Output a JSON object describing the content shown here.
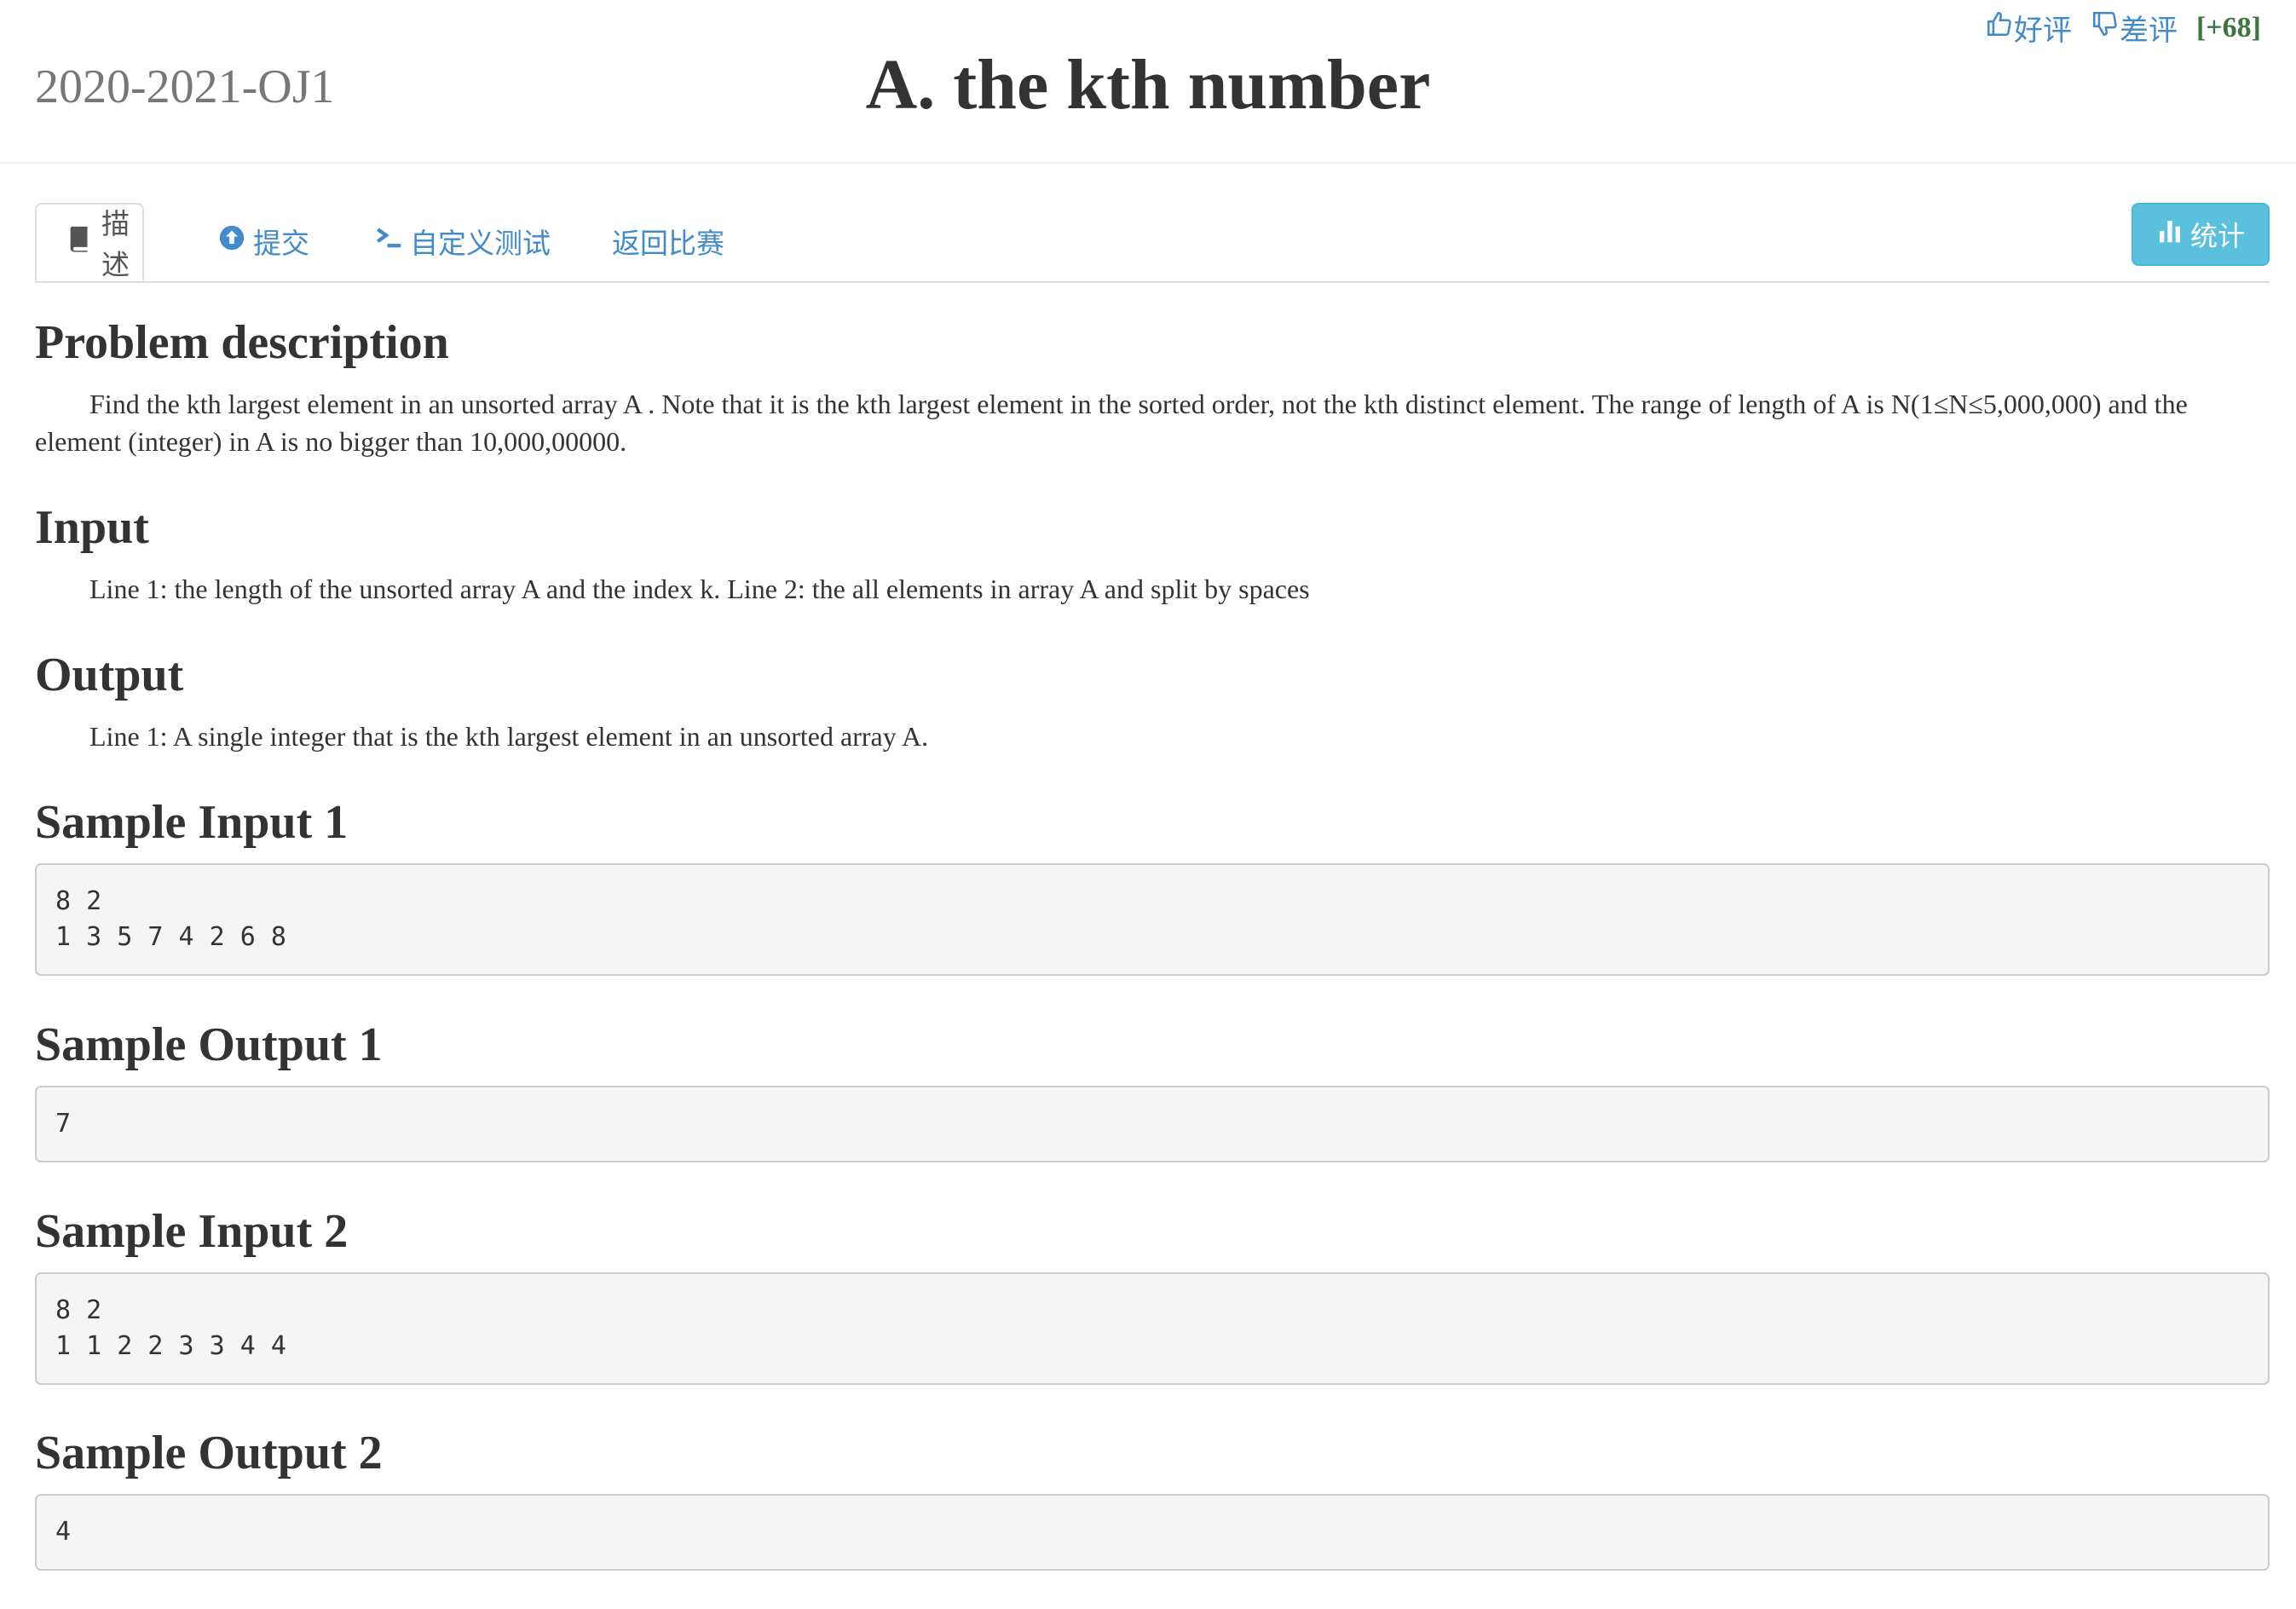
{
  "header": {
    "contest_name": "2020-2021-OJ1",
    "problem_title": "A. the kth number",
    "rating": {
      "like_label": "好评",
      "dislike_label": "差评",
      "score": "[+68]"
    }
  },
  "tabs": {
    "items": [
      {
        "label": "描述",
        "icon": "book-icon"
      },
      {
        "label": "提交",
        "icon": "upload-circle-icon"
      },
      {
        "label": "自定义测试",
        "icon": "terminal-icon"
      },
      {
        "label": "返回比赛",
        "icon": ""
      }
    ],
    "stat_button": {
      "label": "统计",
      "icon": "bar-chart-icon"
    }
  },
  "sections": {
    "description": {
      "heading": "Problem description",
      "text": "Find the kth largest element in an unsorted array A . Note that it is the kth largest element in the sorted order, not the kth distinct element. The range of length of A is N(1≤N≤5,000,000) and the element (integer) in A is no bigger than 10,000,00000."
    },
    "input": {
      "heading": "Input",
      "text": "Line 1: the length of the unsorted array A and the index k. Line 2: the all elements in array A and split by spaces"
    },
    "output": {
      "heading": "Output",
      "text": "Line 1: A single integer that is the kth largest element in an unsorted array A."
    },
    "sample_input_1": {
      "heading": "Sample Input 1",
      "code": "8 2\n1 3 5 7 4 2 6 8"
    },
    "sample_output_1": {
      "heading": "Sample Output 1",
      "code": "7"
    },
    "sample_input_2": {
      "heading": "Sample Input 2",
      "code": "8 2\n1 1 2 2 3 3 4 4"
    },
    "sample_output_2": {
      "heading": "Sample Output 2",
      "code": "4"
    }
  },
  "colors": {
    "link": "#428bca",
    "score": "#3c763d",
    "stat_button": "#5bc0de",
    "code_bg": "#f5f5f5"
  }
}
